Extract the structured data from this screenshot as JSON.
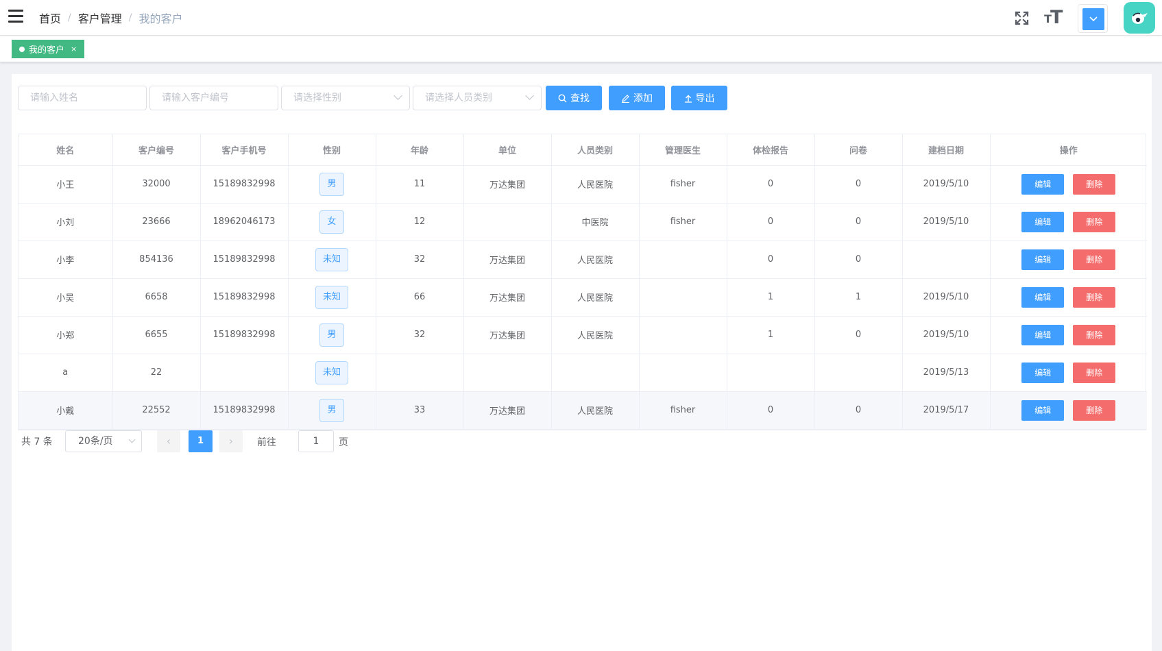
{
  "navbar": {
    "breadcrumb": [
      "首页",
      "客户管理",
      "我的客户"
    ],
    "separator": "/",
    "icons": [
      "hamburger-icon",
      "fullscreen-icon",
      "font-size-icon",
      "chevron-down-icon",
      "avatar"
    ],
    "font_size_glyph_small": "T",
    "font_size_glyph_large": "T"
  },
  "tags": [
    {
      "label": "我的客户",
      "close": "×"
    }
  ],
  "search": {
    "name_placeholder": "请输入姓名",
    "code_placeholder": "请输入客户编号",
    "gender_placeholder": "请选择性别",
    "category_placeholder": "请选择人员类别",
    "search_label": "查找",
    "add_label": "添加",
    "export_label": "导出"
  },
  "table": {
    "columns": [
      "姓名",
      "客户编号",
      "客户手机号",
      "性别",
      "年龄",
      "单位",
      "人员类别",
      "管理医生",
      "体检报告",
      "问卷",
      "建档日期",
      "操作"
    ],
    "edit_label": "编辑",
    "delete_label": "删除",
    "rows": [
      {
        "name": "小王",
        "code": "32000",
        "phone": "15189832998",
        "gender": "男",
        "age": "11",
        "unit": "万达集团",
        "category": "人民医院",
        "doctor": "fisher",
        "report": "0",
        "survey": "0",
        "date": "2019/5/10"
      },
      {
        "name": "小刘",
        "code": "23666",
        "phone": "18962046173",
        "gender": "女",
        "age": "12",
        "unit": "",
        "category": "中医院",
        "doctor": "fisher",
        "report": "0",
        "survey": "0",
        "date": "2019/5/10"
      },
      {
        "name": "小李",
        "code": "854136",
        "phone": "15189832998",
        "gender": "未知",
        "age": "32",
        "unit": "万达集团",
        "category": "人民医院",
        "doctor": "",
        "report": "0",
        "survey": "0",
        "date": ""
      },
      {
        "name": "小吴",
        "code": "6658",
        "phone": "15189832998",
        "gender": "未知",
        "age": "66",
        "unit": "万达集团",
        "category": "人民医院",
        "doctor": "",
        "report": "1",
        "survey": "1",
        "date": "2019/5/10"
      },
      {
        "name": "小郑",
        "code": "6655",
        "phone": "15189832998",
        "gender": "男",
        "age": "32",
        "unit": "万达集团",
        "category": "人民医院",
        "doctor": "",
        "report": "1",
        "survey": "0",
        "date": "2019/5/10"
      },
      {
        "name": "a",
        "code": "22",
        "phone": "",
        "gender": "未知",
        "age": "",
        "unit": "",
        "category": "",
        "doctor": "",
        "report": "",
        "survey": "",
        "date": "2019/5/13"
      },
      {
        "name": "小戴",
        "code": "22552",
        "phone": "15189832998",
        "gender": "男",
        "age": "33",
        "unit": "万达集团",
        "category": "人民医院",
        "doctor": "fisher",
        "report": "0",
        "survey": "0",
        "date": "2019/5/17"
      }
    ]
  },
  "pager": {
    "total": "共 7 条",
    "page_size": "20条/页",
    "prev": "‹",
    "next": "›",
    "current_page": "1",
    "goto_prefix": "前往",
    "goto_value": "1",
    "goto_suffix": "页"
  },
  "colors": {
    "primary": "#409eff",
    "danger": "#f56c6c",
    "tag_active": "#42b983",
    "avatar_bg": "#48d4c4"
  }
}
